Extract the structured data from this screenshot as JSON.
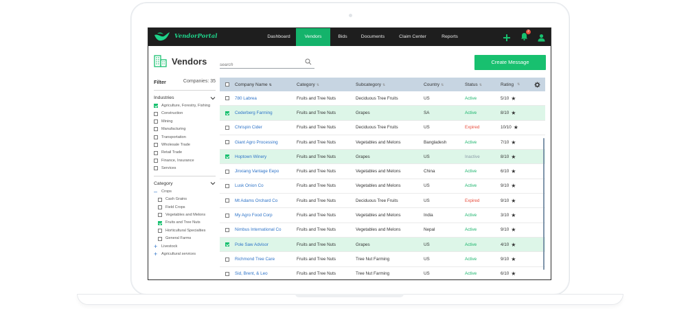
{
  "app": {
    "name": "VendorPortal"
  },
  "nav": {
    "items": [
      {
        "label": "Dashboard",
        "active": false
      },
      {
        "label": "Vendors",
        "active": true
      },
      {
        "label": "Bids",
        "active": false
      },
      {
        "label": "Documents",
        "active": false
      },
      {
        "label": "Claim Center",
        "active": false
      },
      {
        "label": "Reports",
        "active": false
      }
    ],
    "icons": [
      "plus-icon",
      "bell-icon",
      "user-icon"
    ],
    "notification_count": "2"
  },
  "page": {
    "title": "Vendors",
    "create_button": "Create Message"
  },
  "search": {
    "placeholder": "search"
  },
  "sidebar": {
    "filter_label": "Filter",
    "companies_count": "Companies: 35",
    "industries_label": "Industries",
    "industries": [
      {
        "label": "Agriculture, Forestry, Fishing",
        "checked": true
      },
      {
        "label": "Construction",
        "checked": false
      },
      {
        "label": "Mining",
        "checked": false
      },
      {
        "label": "Manufacturing",
        "checked": false
      },
      {
        "label": "Transportation",
        "checked": false
      },
      {
        "label": "Wholesale Trade",
        "checked": false
      },
      {
        "label": "Retail Trade",
        "checked": false
      },
      {
        "label": "Finance, Insurance",
        "checked": false
      },
      {
        "label": "Services",
        "checked": false
      }
    ],
    "category_label": "Category",
    "crops_label": "Crops",
    "crops": [
      {
        "label": "Cash Grains",
        "checked": false
      },
      {
        "label": "Field Crops",
        "checked": false
      },
      {
        "label": "Vegetables and Melons",
        "checked": false
      },
      {
        "label": "Fruits and Tree Nuts",
        "checked": true
      },
      {
        "label": "Horticultural Specialties",
        "checked": false
      },
      {
        "label": "General Farms",
        "checked": false
      }
    ],
    "livestock_label": "Livestock",
    "agri_services_label": "Agricultural services"
  },
  "table": {
    "columns": [
      "Company Name",
      "Category",
      "Subcategory",
      "Country",
      "Status",
      "Rating"
    ],
    "rows": [
      {
        "checked": false,
        "company": "780 Labrea",
        "category": "Fruits and Tree Nuts",
        "subcategory": "Deciduous Tree Fruits",
        "country": "US",
        "status": "Active",
        "rating": "5/10"
      },
      {
        "checked": true,
        "company": "Cederberg Farming",
        "category": "Fruits and Tree Nuts",
        "subcategory": "Grapes",
        "country": "SA",
        "status": "Active",
        "rating": "8/10"
      },
      {
        "checked": false,
        "company": "Chrispin Cider",
        "category": "Fruits and Tree Nuts",
        "subcategory": "Deciduous Tree Fruits",
        "country": "US",
        "status": "Expired",
        "rating": "10/10"
      },
      {
        "checked": false,
        "company": "Giant Agro Processing",
        "category": "Fruits and Tree Nuts",
        "subcategory": "Vegetables and Melons",
        "country": "Bangladesh",
        "status": "Active",
        "rating": "7/10"
      },
      {
        "checked": true,
        "company": "Hoptown Winery",
        "category": "Fruits and Tree Nuts",
        "subcategory": "Grapes",
        "country": "US",
        "status": "Inactive",
        "rating": "8/10"
      },
      {
        "checked": false,
        "company": "Jinxiang Vantage Eepo",
        "category": "Fruits and Tree Nuts",
        "subcategory": "Vegetables and Melons",
        "country": "China",
        "status": "Active",
        "rating": "6/10"
      },
      {
        "checked": false,
        "company": "Lusk Onion Co",
        "category": "Fruits and Tree Nuts",
        "subcategory": "Vegetables and Melons",
        "country": "US",
        "status": "Active",
        "rating": "9/10"
      },
      {
        "checked": false,
        "company": "Mt Adams Orchard Co",
        "category": "Fruits and Tree Nuts",
        "subcategory": "Deciduous Tree Fruits",
        "country": "US",
        "status": "Expired",
        "rating": "9/10"
      },
      {
        "checked": false,
        "company": "My Agro Food Corp",
        "category": "Fruits and Tree Nuts",
        "subcategory": "Vegetables and Melons",
        "country": "India",
        "status": "Active",
        "rating": "3/10"
      },
      {
        "checked": false,
        "company": "Nimbus International Co",
        "category": "Fruits and Tree Nuts",
        "subcategory": "Vegetables and Melons",
        "country": "Nepal",
        "status": "Active",
        "rating": "9/10"
      },
      {
        "checked": true,
        "company": "Pole Saw Advisor",
        "category": "Fruits and Tree Nuts",
        "subcategory": "Grapes",
        "country": "US",
        "status": "Active",
        "rating": "4/10"
      },
      {
        "checked": false,
        "company": "Richmond Tree Care",
        "category": "Fruits and Tree Nuts",
        "subcategory": "Tree Nut Farming",
        "country": "US",
        "status": "Active",
        "rating": "9/10"
      },
      {
        "checked": false,
        "company": "Sid, Brent, & Leo",
        "category": "Fruits and Tree Nuts",
        "subcategory": "Tree Nut Farming",
        "country": "US",
        "status": "Active",
        "rating": "6/10"
      }
    ]
  },
  "colors": {
    "accent": "#18c06f",
    "nav_bg": "#1e1e1e",
    "link": "#2c72c7",
    "expired": "#e74c3c",
    "header_bg": "#c7d5e2",
    "selected_row": "#ddf6e8"
  }
}
